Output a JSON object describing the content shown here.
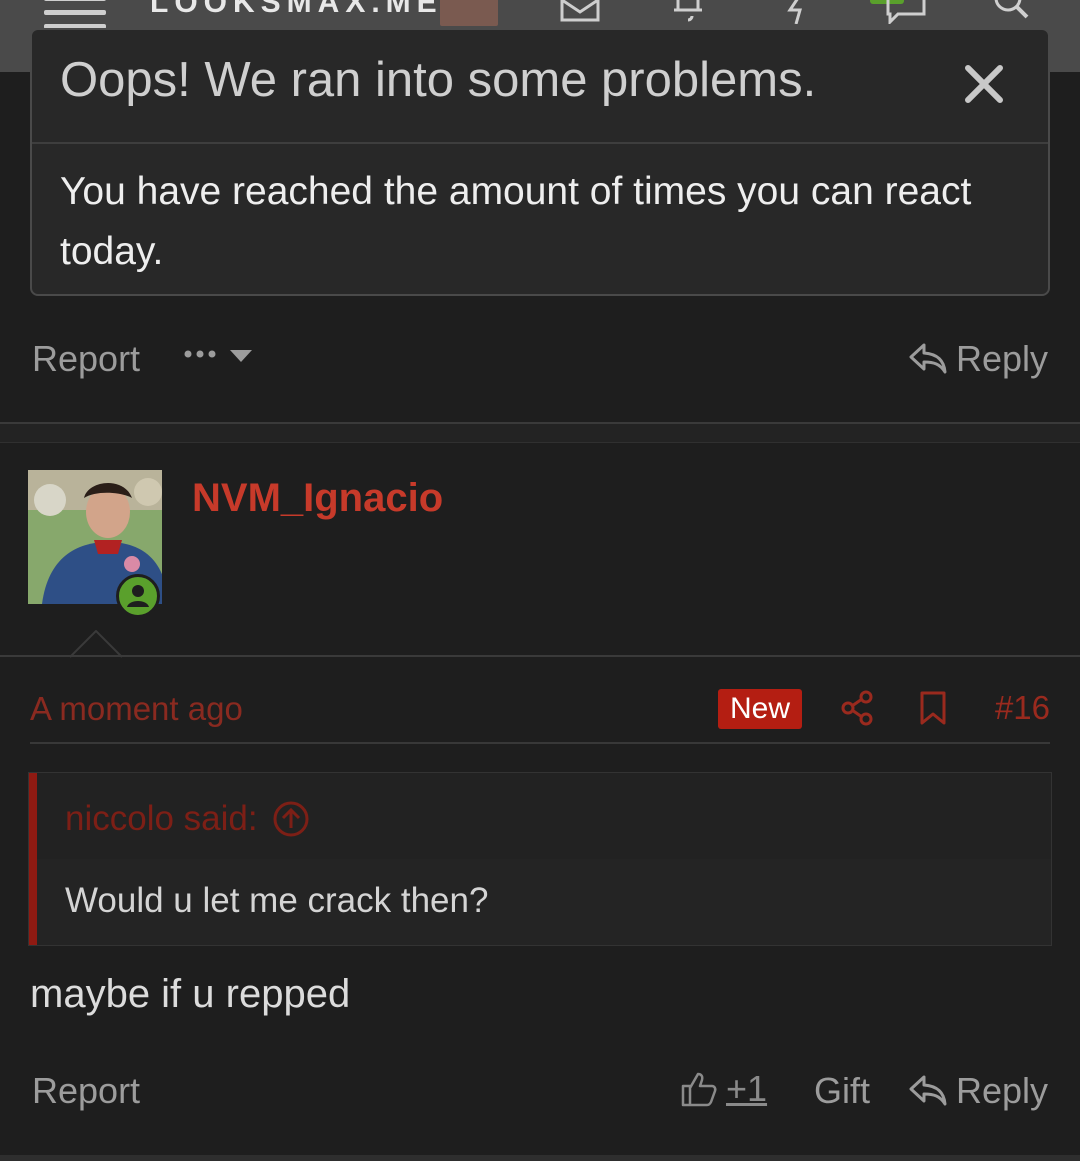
{
  "nav": {
    "logo_text": "LOOKSMAX.ME"
  },
  "dialog": {
    "title": "Oops! We ran into some problems.",
    "message": "You have reached the amount of times you can react today."
  },
  "previous_post": {
    "report_label": "Report",
    "reply_label": "Reply"
  },
  "post": {
    "username": "NVM_Ignacio",
    "time": "A moment ago",
    "badge": "New",
    "number": "#16",
    "quote": {
      "author": "niccolo said:",
      "text": "Would u let me crack then?"
    },
    "message": "maybe if u repped",
    "actions": {
      "report_label": "Report",
      "like_count": "+1",
      "gift_label": "Gift",
      "reply_label": "Reply"
    }
  },
  "colors": {
    "accent": "#c73a2a",
    "background": "#1e1e1e",
    "online": "#5aa02c"
  }
}
